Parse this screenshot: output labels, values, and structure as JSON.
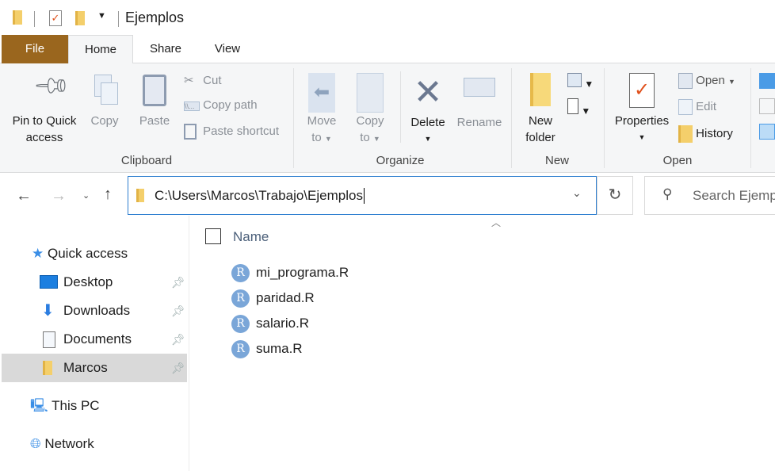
{
  "window": {
    "title": "Ejemplos"
  },
  "tabs": [
    {
      "label": "File"
    },
    {
      "label": "Home"
    },
    {
      "label": "Share"
    },
    {
      "label": "View"
    }
  ],
  "ribbon": {
    "clipboard": {
      "label": "Clipboard",
      "pin": "Pin to Quick access",
      "pin1": "Pin to Quick",
      "pin2": "access",
      "copy": "Copy",
      "paste": "Paste",
      "cut": "Cut",
      "copy_path": "Copy path",
      "paste_shortcut": "Paste shortcut"
    },
    "organize": {
      "label": "Organize",
      "move1": "Move",
      "move2": "to",
      "copy1": "Copy",
      "copy2": "to",
      "delete": "Delete",
      "rename": "Rename"
    },
    "new": {
      "label": "New",
      "folder1": "New",
      "folder2": "folder"
    },
    "open": {
      "label": "Open",
      "properties": "Properties",
      "open": "Open",
      "edit": "Edit",
      "history": "History"
    }
  },
  "address": {
    "path": "C:\\Users\\Marcos\\Trabajo\\Ejemplos",
    "search_placeholder": "Search Ejemplos"
  },
  "nav": {
    "quick_access": "Quick access",
    "items": [
      {
        "label": "Desktop"
      },
      {
        "label": "Downloads"
      },
      {
        "label": "Documents"
      },
      {
        "label": "Marcos"
      }
    ],
    "this_pc": "This PC",
    "network": "Network"
  },
  "list": {
    "column_name": "Name",
    "files": [
      {
        "name": "mi_programa.R"
      },
      {
        "name": "paridad.R"
      },
      {
        "name": "salario.R"
      },
      {
        "name": "suma.R"
      }
    ]
  },
  "colors": {
    "file_tab": "#9a661e",
    "accent": "#2f7fd0",
    "selected": "#d9d9d9"
  }
}
